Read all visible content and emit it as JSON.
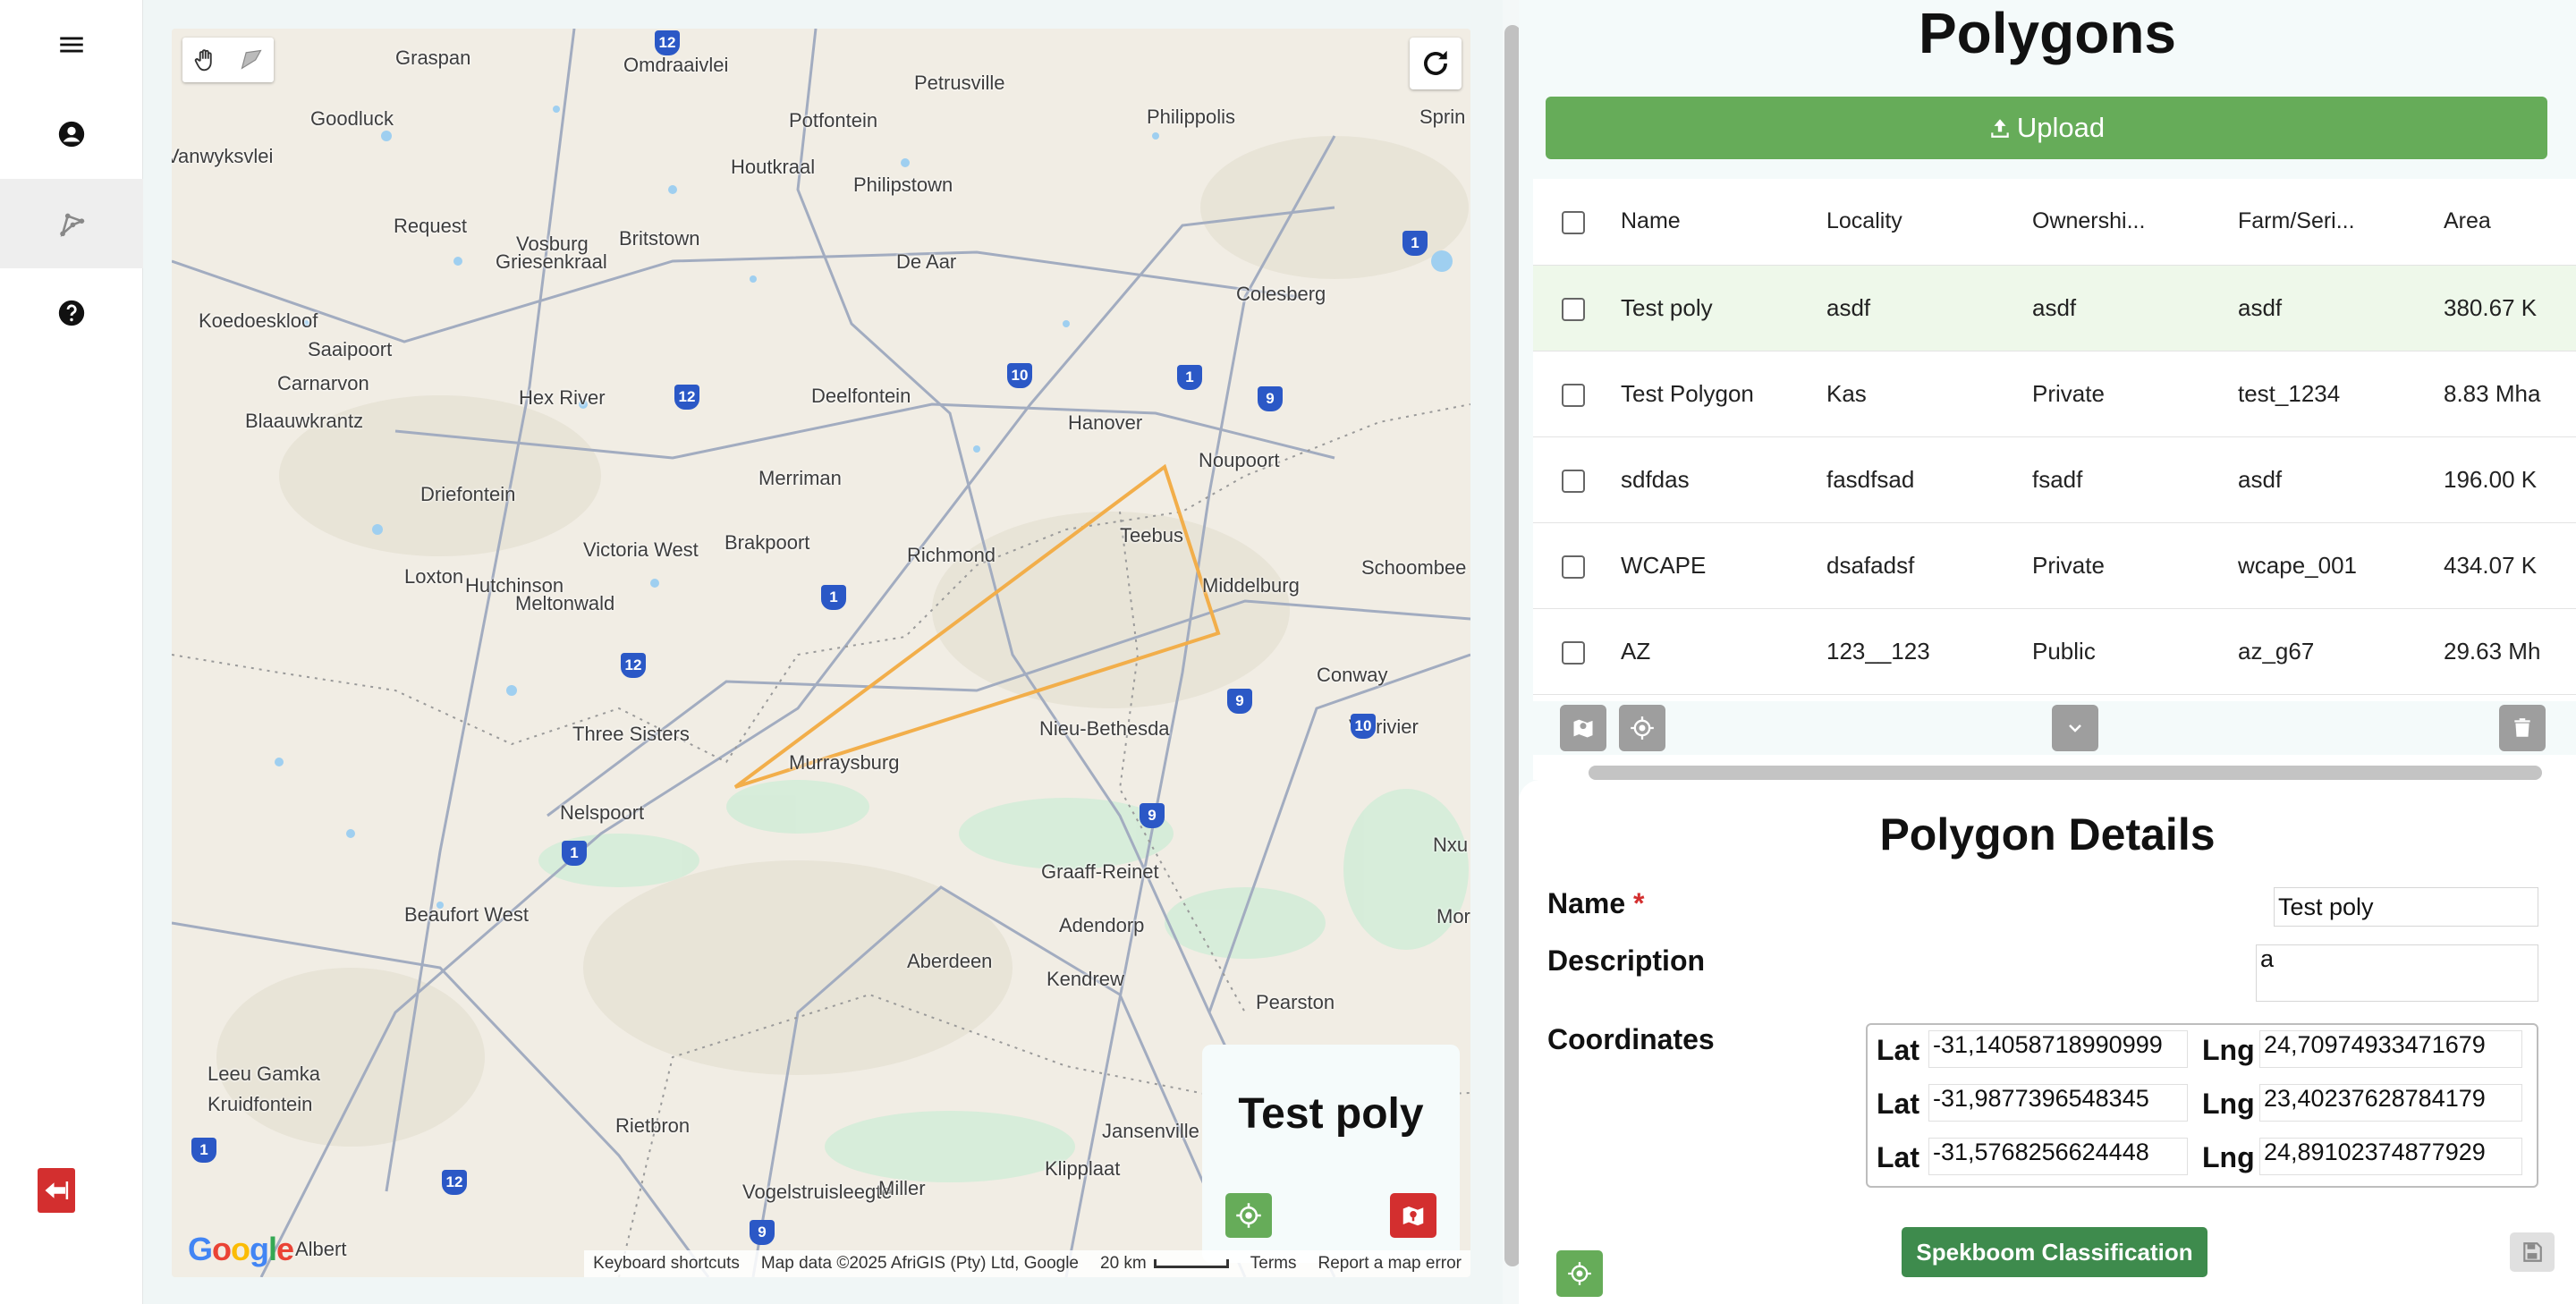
{
  "map": {
    "cities": [
      {
        "name": "Graspan"
      },
      {
        "name": "Omdraaivlei"
      },
      {
        "name": "Petrusville"
      },
      {
        "name": "Goodluck"
      },
      {
        "name": "Potfontein"
      },
      {
        "name": "Philippolis"
      },
      {
        "name": "Sprin"
      },
      {
        "name": "Vanwyksvlei"
      },
      {
        "name": "Houtkraal"
      },
      {
        "name": "Philipstown"
      },
      {
        "name": "Request"
      },
      {
        "name": "Vosburg"
      },
      {
        "name": "Britstown"
      },
      {
        "name": "Griesenkraal"
      },
      {
        "name": "De Aar"
      },
      {
        "name": "Colesberg"
      },
      {
        "name": "Koedoeskloof"
      },
      {
        "name": "Saaipoort"
      },
      {
        "name": "Carnarvon"
      },
      {
        "name": "Hex River"
      },
      {
        "name": "Deelfontein"
      },
      {
        "name": "Blaauwkrantz"
      },
      {
        "name": "Hanover"
      },
      {
        "name": "Noupoort"
      },
      {
        "name": "Driefontein"
      },
      {
        "name": "Merriman"
      },
      {
        "name": "Victoria West"
      },
      {
        "name": "Brakpoort"
      },
      {
        "name": "Richmond"
      },
      {
        "name": "Teebus"
      },
      {
        "name": "Loxton"
      },
      {
        "name": "Hutchinson"
      },
      {
        "name": "Middelburg"
      },
      {
        "name": "Schoombee"
      },
      {
        "name": "Meltonwald"
      },
      {
        "name": "Conway"
      },
      {
        "name": "Three Sisters"
      },
      {
        "name": "Nieu-Bethesda"
      },
      {
        "name": "Murraysburg"
      },
      {
        "name": "Visrivier"
      },
      {
        "name": "Nelspoort"
      },
      {
        "name": "Nxu"
      },
      {
        "name": "Graaff-Reinet"
      },
      {
        "name": "Beaufort West"
      },
      {
        "name": "Adendorp"
      },
      {
        "name": "Mor"
      },
      {
        "name": "Aberdeen"
      },
      {
        "name": "Kendrew"
      },
      {
        "name": "Pearston"
      },
      {
        "name": "Leeu Gamka"
      },
      {
        "name": "Kruidfontein"
      },
      {
        "name": "Rietbron"
      },
      {
        "name": "Jansenville"
      },
      {
        "name": "Klipplaat"
      },
      {
        "name": "Vogelstruisleegte"
      },
      {
        "name": "Miller"
      },
      {
        "name": "Albert"
      }
    ],
    "routes": [
      "12",
      "1",
      "10",
      "1",
      "9",
      "12",
      "1",
      "12",
      "9",
      "10",
      "1",
      "9",
      "12",
      "9",
      "1"
    ],
    "attribution": {
      "keyboard": "Keyboard shortcuts",
      "mapdata": "Map data ©2025 AfriGIS (Pty) Ltd, Google",
      "scale": "20 km",
      "terms": "Terms",
      "report": "Report a map error"
    },
    "google_logo": [
      "G",
      "o",
      "o",
      "g",
      "l",
      "e"
    ],
    "polygon_color": "#f2ae4a",
    "selected_polygon_name": "Test poly"
  },
  "polygons": {
    "title": "Polygons",
    "upload_label": "Upload",
    "columns": [
      "Name",
      "Locality",
      "Ownershi...",
      "Farm/Seri...",
      "Area"
    ],
    "rows": [
      {
        "name": "Test poly",
        "locality": "asdf",
        "ownership": "asdf",
        "farm": "asdf",
        "area": "380.67 K",
        "selected": true
      },
      {
        "name": "Test Polygon",
        "locality": "Kas",
        "ownership": "Private",
        "farm": "test_1234",
        "area": "8.83 Mha",
        "selected": false
      },
      {
        "name": "sdfdas",
        "locality": "fasdfsad",
        "ownership": "fsadf",
        "farm": "asdf",
        "area": "196.00 K",
        "selected": false
      },
      {
        "name": "WCAPE",
        "locality": "dsafadsf",
        "ownership": "Private",
        "farm": "wcape_001",
        "area": "434.07 K",
        "selected": false
      },
      {
        "name": "AZ",
        "locality": "123__123",
        "ownership": "Public",
        "farm": "az_g67",
        "area": "29.63 Mh",
        "selected": false
      }
    ]
  },
  "details": {
    "title": "Polygon Details",
    "name_label": "Name",
    "required_mark": "*",
    "name_value": "Test poly",
    "description_label": "Description",
    "description_value": "a",
    "coordinates_label": "Coordinates",
    "lat_label": "Lat",
    "lng_label": "Lng",
    "coords": [
      {
        "lat": "-31,14058718990999",
        "lng": "24,70974933471679"
      },
      {
        "lat": "-31,9877396548345",
        "lng": "23,40237628784179"
      },
      {
        "lat": "-31,5768256624448",
        "lng": "24,89102374877929"
      }
    ],
    "classify_label": "Spekboom Classification"
  },
  "colors": {
    "green": "#66ac59",
    "dark_green": "#3e8b4d",
    "red": "#d32f2f",
    "route_blue": "#2b58c6"
  }
}
